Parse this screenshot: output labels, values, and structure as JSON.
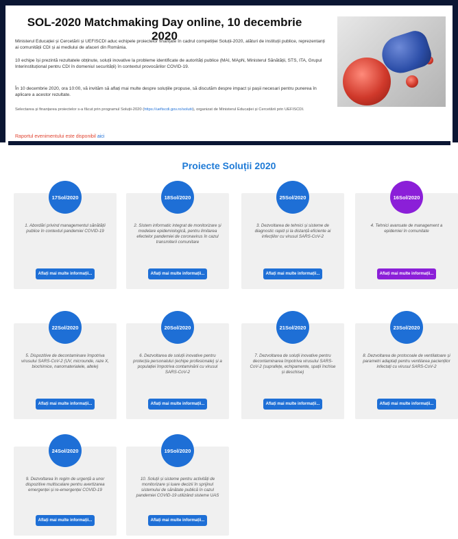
{
  "hero": {
    "title": "SOL-2020 Matchmaking Day online, 10 decembrie 2020",
    "p1": "Ministerul Educației și Cercetării și UEFISCDI aduc echipele proiectelor finanțate în cadrul competiției Soluții-2020, alături de instituții publice, reprezentanți ai comunității CDI și ai mediului de afaceri din România.",
    "p2": "10 echipe își prezintă rezultatele obținute, soluții inovative la probleme identificate de autorități publice (MAI, MApN, Ministerul Sănătății, STS, ITA, Grupul Interinstituțional pentru CDI în domeniul securității) în contextul provocărilor COVID-19.",
    "p3": "În 10 decembrie 2020, ora 10:00, vă invităm să aflați mai multe despre soluțiile propuse, să discutăm despre impact și pașii necesari pentru punerea în aplicare a acestor rezultate.",
    "p4_prefix": "Selectarea și finanțarea proiectelor s-a făcut prin programul Soluții-2020 (",
    "p4_link": "https://uefiscdi.gov.ro/solutii",
    "p4_suffix": "), organizat de Ministerul Educației și Cercetării prin UEFISCDI.",
    "report_text": "Raportul evenimentului este disponibil ",
    "report_link": "aici",
    "image_alt": "blue boxing glove punching virus"
  },
  "section_title": "Proiecte Soluții 2020",
  "colors": {
    "blue": "#1e6fd6",
    "purple": "#8b1fd8",
    "card_bg": "#f0f0f0",
    "title_blue": "#1e7ad6"
  },
  "cards": [
    {
      "code": "17Sol/2020",
      "text": "1. Abordări privind managementul sănătății publice în contextul pandemiei COVID-19",
      "button": "Aflați mai multe informații...",
      "color": "blue"
    },
    {
      "code": "18Sol/2020",
      "text": "2. Sistem informatic integrat de monitorizare și modelare epidemiologică, pentru limitarea efectelor pandemiei de coronavirus în cazul transmiterii comunitare",
      "button": "Aflați mai multe informații...",
      "color": "blue"
    },
    {
      "code": "25Sol/2020",
      "text": "3. Dezvoltarea de tehnici și sisteme de diagnostic rapid și la distanță eficiente ai infecțiilor cu virusul SARS-CoV-2",
      "button": "Aflați mai multe informații...",
      "color": "blue"
    },
    {
      "code": "16Sol/2020",
      "text": "4. Tehnici avansate de management a epidemiei în comunitate",
      "button": "Aflați mai multe informații...",
      "color": "purple"
    },
    {
      "code": "22Sol/2020",
      "text": "5. Dispozitive de decontaminare împotriva virusului SARS-CoV-2 (UV, microunde, raze X, biochimice, nanomaterialele, altele)",
      "button": "Aflați mai multe informații...",
      "color": "blue"
    },
    {
      "code": "20Sol/2020",
      "text": "6. Dezvoltarea de soluții inovative pentru protecția personalului (echipe profesionale) și a populației împotriva contaminării cu virusul SARS-CoV-2",
      "button": "Aflați mai multe informații...",
      "color": "blue"
    },
    {
      "code": "21Sol/2020",
      "text": "7. Dezvoltarea de soluții inovative pentru decontaminarea împotriva virusului SARS-CoV-2 (suprafețe, echipamente, spații închise și deschise)",
      "button": "Aflați mai multe informații...",
      "color": "blue"
    },
    {
      "code": "23Sol/2020",
      "text": "8. Dezvoltarea de protocoale de ventilatoare și parametri adaptați pentru ventilarea pacienților infectați cu virusul SARS-CoV-2",
      "button": "Aflați mai multe informații...",
      "color": "blue"
    },
    {
      "code": "24Sol/2020",
      "text": "9. Dezvoltarea în regim de urgență a unor dispozitive multiscalare pentru avertizarea emergenței și re-emergenței COVID-19",
      "button": "Aflați mai multe informații...",
      "color": "blue"
    },
    {
      "code": "19Sol/2020",
      "text": "10. Soluții și sisteme pentru activități de monitorizare și luare decizii în sprijinul sistemului de sănătate publică în cazul pandemiei COVID-19 utilizând sisteme UAS",
      "button": "Aflați mai multe informații...",
      "color": "blue"
    }
  ]
}
